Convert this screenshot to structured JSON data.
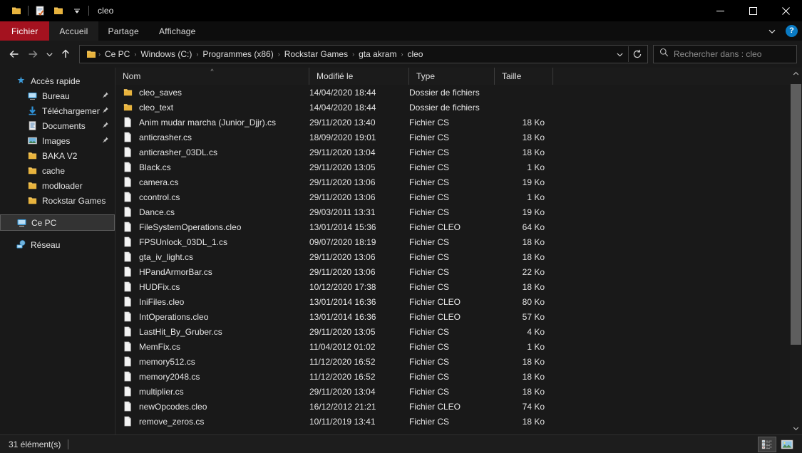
{
  "window": {
    "title": "cleo",
    "quick_access": [
      "folder-icon",
      "properties-icon",
      "new-folder-icon",
      "customize-dropdown-icon"
    ],
    "controls": {
      "minimize": "minimize-icon",
      "maximize": "maximize-icon",
      "close": "close-icon"
    }
  },
  "ribbon": {
    "tabs": [
      {
        "label": "Fichier",
        "id": "fichier",
        "active": false,
        "file_menu": true
      },
      {
        "label": "Accueil",
        "id": "accueil",
        "active": true
      },
      {
        "label": "Partage",
        "id": "partage",
        "active": false
      },
      {
        "label": "Affichage",
        "id": "affichage",
        "active": false
      }
    ],
    "expand_label": "chevron-down-icon",
    "help_label": "?"
  },
  "address": {
    "back": "back-arrow-icon",
    "forward": "forward-arrow-icon",
    "recent": "chevron-down-icon",
    "up": "up-arrow-icon",
    "breadcrumbs": [
      "Ce PC",
      "Windows (C:)",
      "Programmes (x86)",
      "Rockstar Games",
      "gta akram",
      "cleo"
    ],
    "separator": "›",
    "history_dropdown": "chevron-down-icon",
    "refresh": "refresh-icon"
  },
  "search": {
    "icon": "search-icon",
    "placeholder": "Rechercher dans : cleo"
  },
  "sidebar": {
    "items": [
      {
        "label": "Accès rapide",
        "icon": "star-icon",
        "depth": 0,
        "pinned": false,
        "selected": false
      },
      {
        "label": "Bureau",
        "icon": "desktop-icon",
        "depth": 1,
        "pinned": true,
        "selected": false
      },
      {
        "label": "Téléchargements",
        "icon": "download-icon",
        "depth": 1,
        "pinned": true,
        "selected": false
      },
      {
        "label": "Documents",
        "icon": "documents-icon",
        "depth": 1,
        "pinned": true,
        "selected": false
      },
      {
        "label": "Images",
        "icon": "pictures-icon",
        "depth": 1,
        "pinned": true,
        "selected": false
      },
      {
        "label": "BAKA V2",
        "icon": "folder-icon",
        "depth": 1,
        "pinned": false,
        "selected": false
      },
      {
        "label": "cache",
        "icon": "folder-icon",
        "depth": 1,
        "pinned": false,
        "selected": false
      },
      {
        "label": "modloader",
        "icon": "folder-icon",
        "depth": 1,
        "pinned": false,
        "selected": false
      },
      {
        "label": "Rockstar Games",
        "icon": "folder-icon",
        "depth": 1,
        "pinned": false,
        "selected": false
      },
      {
        "label": "Ce PC",
        "icon": "computer-icon",
        "depth": 0,
        "pinned": false,
        "selected": true
      },
      {
        "label": "Réseau",
        "icon": "network-icon",
        "depth": 0,
        "pinned": false,
        "selected": false
      }
    ]
  },
  "columns": [
    {
      "key": "name",
      "label": "Nom",
      "sorted": "asc"
    },
    {
      "key": "date",
      "label": "Modifié le",
      "sorted": ""
    },
    {
      "key": "type",
      "label": "Type",
      "sorted": ""
    },
    {
      "key": "size",
      "label": "Taille",
      "sorted": ""
    }
  ],
  "files": [
    {
      "name": "cleo_saves",
      "date": "14/04/2020 18:44",
      "type": "Dossier de fichiers",
      "size": "",
      "icon": "folder-icon"
    },
    {
      "name": "cleo_text",
      "date": "14/04/2020 18:44",
      "type": "Dossier de fichiers",
      "size": "",
      "icon": "folder-icon"
    },
    {
      "name": "Anim mudar marcha (Junior_Djjr).cs",
      "date": "29/11/2020 13:40",
      "type": "Fichier CS",
      "size": "18 Ko",
      "icon": "file-icon"
    },
    {
      "name": "anticrasher.cs",
      "date": "18/09/2020 19:01",
      "type": "Fichier CS",
      "size": "18 Ko",
      "icon": "file-icon"
    },
    {
      "name": "anticrasher_03DL.cs",
      "date": "29/11/2020 13:04",
      "type": "Fichier CS",
      "size": "18 Ko",
      "icon": "file-icon"
    },
    {
      "name": "Black.cs",
      "date": "29/11/2020 13:05",
      "type": "Fichier CS",
      "size": "1 Ko",
      "icon": "file-icon"
    },
    {
      "name": "camera.cs",
      "date": "29/11/2020 13:06",
      "type": "Fichier CS",
      "size": "19 Ko",
      "icon": "file-icon"
    },
    {
      "name": "ccontrol.cs",
      "date": "29/11/2020 13:06",
      "type": "Fichier CS",
      "size": "1 Ko",
      "icon": "file-icon"
    },
    {
      "name": "Dance.cs",
      "date": "29/03/2011 13:31",
      "type": "Fichier CS",
      "size": "19 Ko",
      "icon": "file-icon"
    },
    {
      "name": "FileSystemOperations.cleo",
      "date": "13/01/2014 15:36",
      "type": "Fichier CLEO",
      "size": "64 Ko",
      "icon": "file-icon"
    },
    {
      "name": "FPSUnlock_03DL_1.cs",
      "date": "09/07/2020 18:19",
      "type": "Fichier CS",
      "size": "18 Ko",
      "icon": "file-icon"
    },
    {
      "name": "gta_iv_light.cs",
      "date": "29/11/2020 13:06",
      "type": "Fichier CS",
      "size": "18 Ko",
      "icon": "file-icon"
    },
    {
      "name": "HPandArmorBar.cs",
      "date": "29/11/2020 13:06",
      "type": "Fichier CS",
      "size": "22 Ko",
      "icon": "file-icon"
    },
    {
      "name": "HUDFix.cs",
      "date": "10/12/2020 17:38",
      "type": "Fichier CS",
      "size": "18 Ko",
      "icon": "file-icon"
    },
    {
      "name": "IniFiles.cleo",
      "date": "13/01/2014 16:36",
      "type": "Fichier CLEO",
      "size": "80 Ko",
      "icon": "file-icon"
    },
    {
      "name": "IntOperations.cleo",
      "date": "13/01/2014 16:36",
      "type": "Fichier CLEO",
      "size": "57 Ko",
      "icon": "file-icon"
    },
    {
      "name": "LastHit_By_Gruber.cs",
      "date": "29/11/2020 13:05",
      "type": "Fichier CS",
      "size": "4 Ko",
      "icon": "file-icon"
    },
    {
      "name": "MemFix.cs",
      "date": "11/04/2012 01:02",
      "type": "Fichier CS",
      "size": "1 Ko",
      "icon": "file-icon"
    },
    {
      "name": "memory512.cs",
      "date": "11/12/2020 16:52",
      "type": "Fichier CS",
      "size": "18 Ko",
      "icon": "file-icon"
    },
    {
      "name": "memory2048.cs",
      "date": "11/12/2020 16:52",
      "type": "Fichier CS",
      "size": "18 Ko",
      "icon": "file-icon"
    },
    {
      "name": "multiplier.cs",
      "date": "29/11/2020 13:04",
      "type": "Fichier CS",
      "size": "18 Ko",
      "icon": "file-icon"
    },
    {
      "name": "newOpcodes.cleo",
      "date": "16/12/2012 21:21",
      "type": "Fichier CLEO",
      "size": "74 Ko",
      "icon": "file-icon"
    },
    {
      "name": "remove_zeros.cs",
      "date": "10/11/2019 13:41",
      "type": "Fichier CS",
      "size": "18 Ko",
      "icon": "file-icon"
    }
  ],
  "status": {
    "count": "31 élément(s)",
    "views": [
      {
        "name": "details-view",
        "active": true
      },
      {
        "name": "large-icons-view",
        "active": false
      }
    ]
  },
  "colors": {
    "accent_red": "#a4121f",
    "folder_yellow": "#e8b33d",
    "help_blue": "#0a7bc4",
    "selection_gray": "#333333",
    "window_bg": "#191919"
  }
}
